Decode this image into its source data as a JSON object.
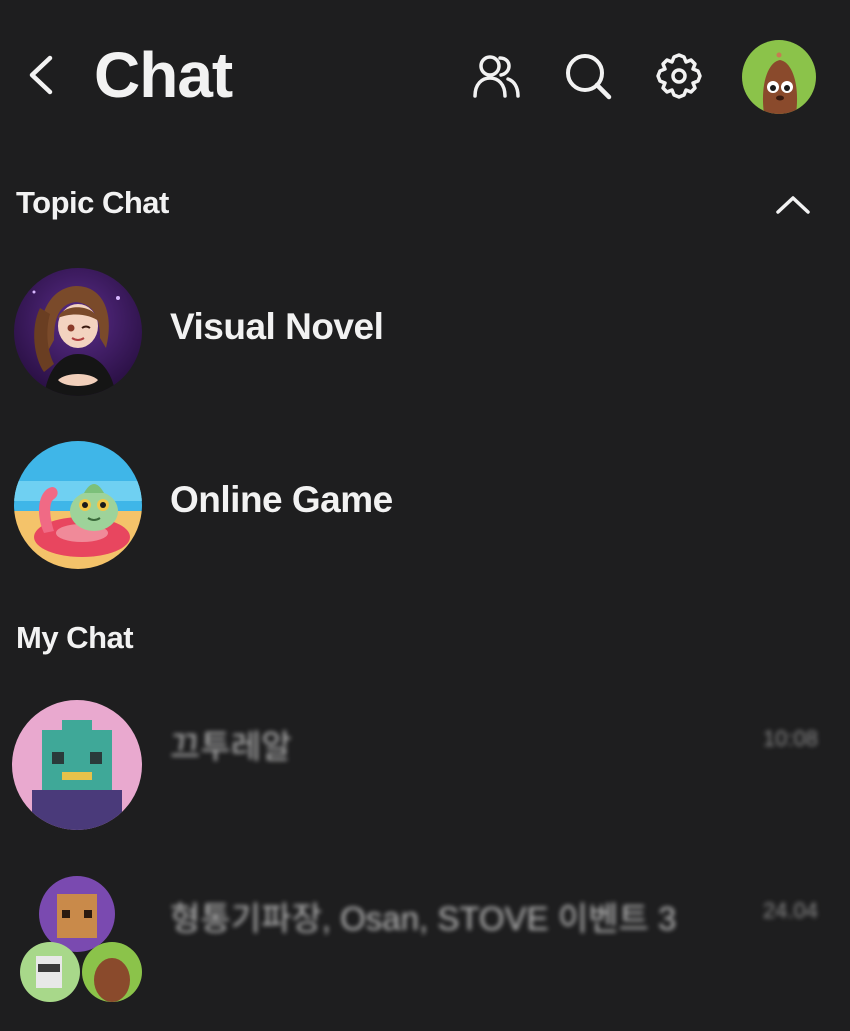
{
  "header": {
    "title": "Chat",
    "icons": {
      "back": "chevron-left-icon",
      "friends": "people-icon",
      "search": "search-icon",
      "settings": "gear-icon"
    },
    "accent": "#8bc34a"
  },
  "topic_section": {
    "title": "Topic Chat",
    "items": [
      {
        "label": "Visual Novel"
      },
      {
        "label": "Online Game"
      }
    ]
  },
  "my_section": {
    "title": "My Chat",
    "items": [
      {
        "name": "끄투레알",
        "time": "10:08"
      },
      {
        "name": "형통기파장, Osan, STOVE 이벤트 3",
        "time": "24.04"
      }
    ]
  }
}
